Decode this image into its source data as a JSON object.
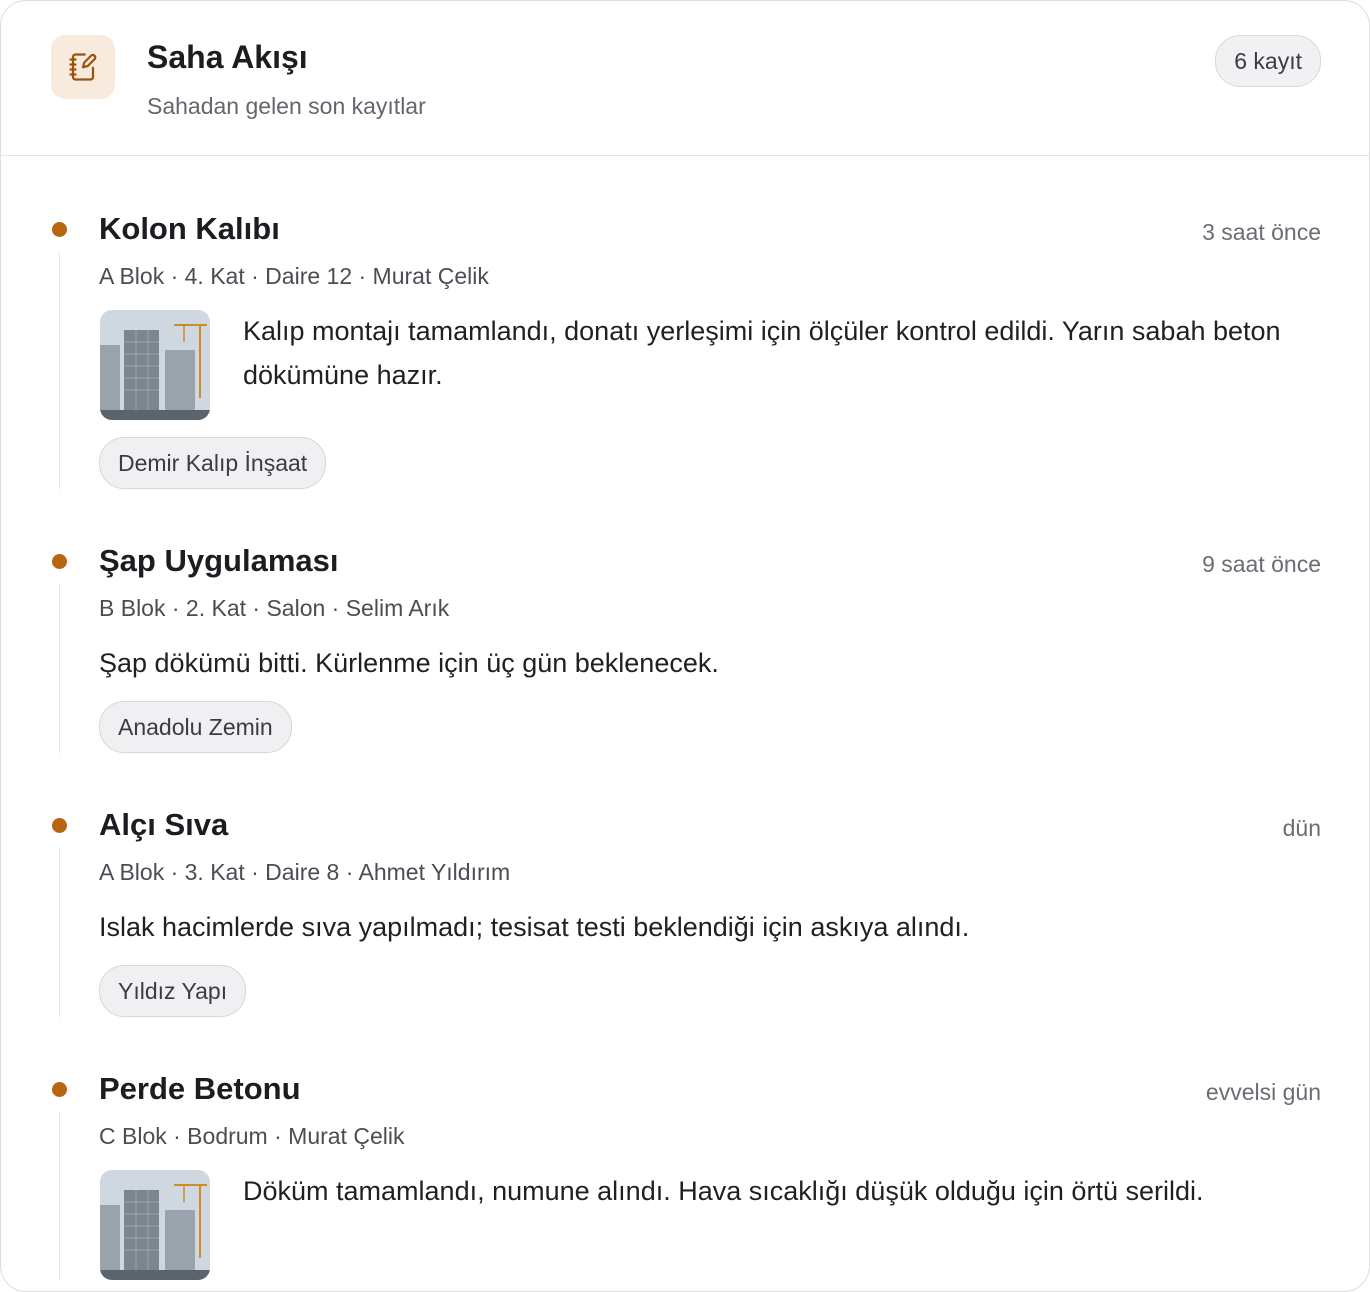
{
  "header": {
    "icon": "notebook-pen-icon",
    "title": "Saha Akışı",
    "subtitle": "Sahadan gelen son kayıtlar",
    "count_label": "6 kayıt"
  },
  "colors": {
    "accent": "#b8650f",
    "icon_bg": "#f8ebdd"
  },
  "entries": [
    {
      "title": "Kolon Kalıbı",
      "time": "3 saat önce",
      "meta": "A Blok · 4. Kat · Daire 12 · Murat Çelik",
      "has_photo": true,
      "text": "Kalıp montajı tamamlandı, donatı yerleşimi için ölçüler kontrol edildi. Yarın sabah beton dökümüne hazır.",
      "tag": "Demir Kalıp İnşaat"
    },
    {
      "title": "Şap Uygulaması",
      "time": "9 saat önce",
      "meta": "B Blok · 2. Kat · Salon · Selim Arık",
      "has_photo": false,
      "text": "Şap dökümü bitti. Kürlenme için üç gün beklenecek.",
      "tag": "Anadolu Zemin"
    },
    {
      "title": "Alçı Sıva",
      "time": "dün",
      "meta": "A Blok · 3. Kat · Daire 8 · Ahmet Yıldırım",
      "has_photo": false,
      "text": "Islak hacimlerde sıva yapılmadı; tesisat testi beklendiği için askıya alındı.",
      "tag": "Yıldız Yapı"
    },
    {
      "title": "Perde Betonu",
      "time": "evvelsi gün",
      "meta": "C Blok · Bodrum · Murat Çelik",
      "has_photo": true,
      "text": "Döküm tamamlandı, numune alındı. Hava sıcaklığı düşük olduğu için örtü serildi.",
      "tag": ""
    }
  ]
}
